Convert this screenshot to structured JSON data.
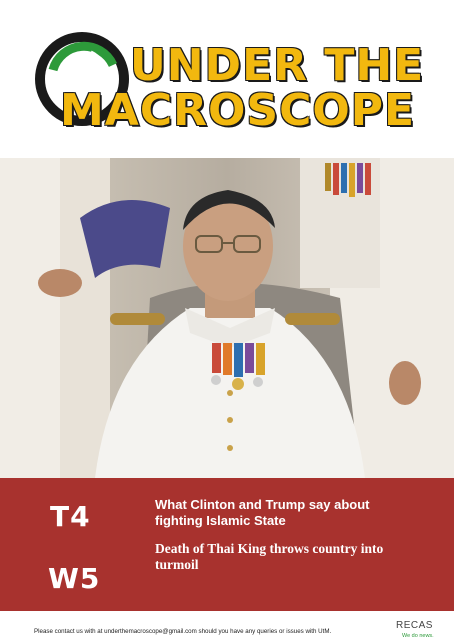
{
  "masthead": {
    "title_line_1": "UNDER THE",
    "title_line_2": "MACROSCOPE",
    "logo_icon": "green-circle-logo-icon",
    "colors": {
      "title": "#f2b80f",
      "logo_ring": "#2d9a3a",
      "outline": "#1a1a1a"
    }
  },
  "cover": {
    "photo_icon": "cover-photo-man-in-white-uniform",
    "panel_color": "#a8322e",
    "issue_term": "T4",
    "issue_week": "W5",
    "headlines": [
      "What Clinton and Trump say about fighting Islamic State",
      "Death of Thai King throws country into turmoil"
    ]
  },
  "footer": {
    "contact_text": "Please contact us with at underthemacroscope@gmail.com should you have any queries or issues with UtM.",
    "brand": "RECAS",
    "tagline": "We do news."
  }
}
